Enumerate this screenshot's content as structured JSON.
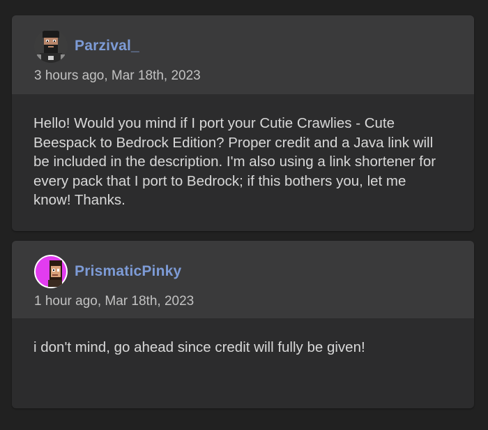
{
  "comments": [
    {
      "username": "Parzival_",
      "timestamp": "3 hours ago, Mar 18th, 2023",
      "body": "Hello! Would you mind if I port your Cutie Crawlies - Cute Beespack to Bedrock Edition? Proper credit and a Java link will be included in the description. I'm also using a link shortener for every pack that I port to Bedrock; if this bothers you, let me know! Thanks."
    },
    {
      "username": "PrismaticPinky",
      "timestamp": "1 hour ago, Mar 18th, 2023",
      "body": "i don't mind, go ahead since credit will fully be given!"
    }
  ],
  "colors": {
    "background": "#212121",
    "card": "#2c2c2d",
    "header": "#3a3a3b",
    "username": "#7d9bd6",
    "text": "#d8d8d8"
  }
}
